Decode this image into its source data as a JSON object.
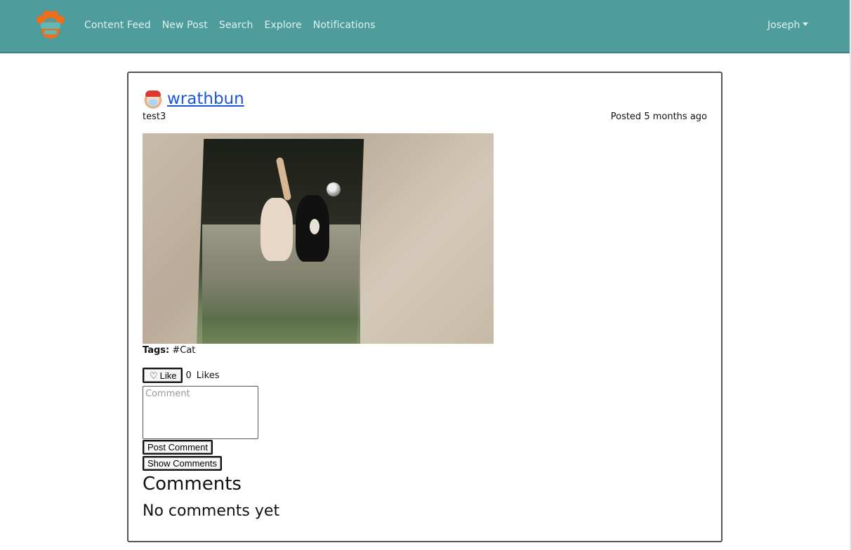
{
  "navbar": {
    "brand_logo_icon": "paw-logo-icon",
    "links": [
      {
        "label": "Content Feed"
      },
      {
        "label": "New Post"
      },
      {
        "label": "Search"
      },
      {
        "label": "Explore"
      },
      {
        "label": "Notifications"
      }
    ],
    "user": {
      "name": "Joseph",
      "icon": "chevron-down-icon"
    },
    "background_color": "#4e9c9c"
  },
  "post": {
    "author": {
      "username": "wrathbun",
      "avatar_icon": "avatar-icon"
    },
    "caption": "test3",
    "posted_label": "Posted 5 months ago",
    "image_alt": "Photo of two cats on a refrigerator",
    "tags": {
      "label": "Tags:",
      "values": [
        "#Cat"
      ]
    },
    "like": {
      "button_label": "Like",
      "count": "0",
      "count_label": "Likes",
      "icon": "heart-icon"
    },
    "comment": {
      "placeholder": "Comment",
      "post_button": "Post Comment",
      "show_button": "Show Comments"
    },
    "comments": {
      "heading": "Comments",
      "empty_text": "No comments yet"
    }
  },
  "colors": {
    "link": "#1a57d8",
    "nav_text": "#dff2f2",
    "card_border": "#555555"
  }
}
